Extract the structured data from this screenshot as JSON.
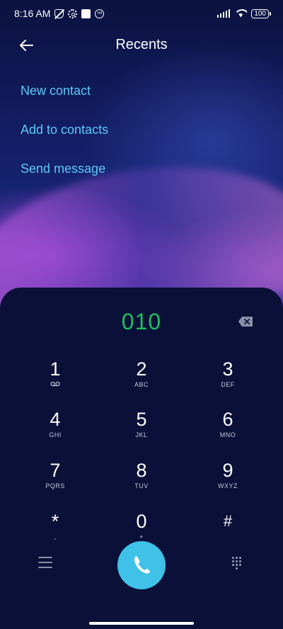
{
  "status_bar": {
    "time": "8:16 AM",
    "icons_left": [
      "mute-icon",
      "gear-icon",
      "square-icon",
      "mi-icon"
    ],
    "icons_right": [
      "signal-icon",
      "wifi-icon",
      "battery-icon"
    ],
    "battery": "100"
  },
  "header": {
    "title": "Recents",
    "back_icon": "arrow-left-icon"
  },
  "actions": [
    {
      "label": "New contact"
    },
    {
      "label": "Add to contacts"
    },
    {
      "label": "Send message"
    }
  ],
  "dialer": {
    "number": "010",
    "backspace_icon": "backspace-icon",
    "keys": [
      {
        "digit": "1",
        "letters": "voicemail-icon"
      },
      {
        "digit": "2",
        "letters": "ABC"
      },
      {
        "digit": "3",
        "letters": "DEF"
      },
      {
        "digit": "4",
        "letters": "GHI"
      },
      {
        "digit": "5",
        "letters": "JKL"
      },
      {
        "digit": "6",
        "letters": "MNO"
      },
      {
        "digit": "7",
        "letters": "PQRS"
      },
      {
        "digit": "8",
        "letters": "TUV"
      },
      {
        "digit": "9",
        "letters": "WXYZ"
      },
      {
        "digit": "*",
        "letters": ","
      },
      {
        "digit": "0",
        "letters": "+"
      },
      {
        "digit": "#",
        "letters": ""
      }
    ]
  },
  "colors": {
    "accent_link": "#5ec8f6",
    "number_green": "#1fbd5c",
    "call_button": "#3fc1e8",
    "panel_bg": "#0a1038"
  }
}
